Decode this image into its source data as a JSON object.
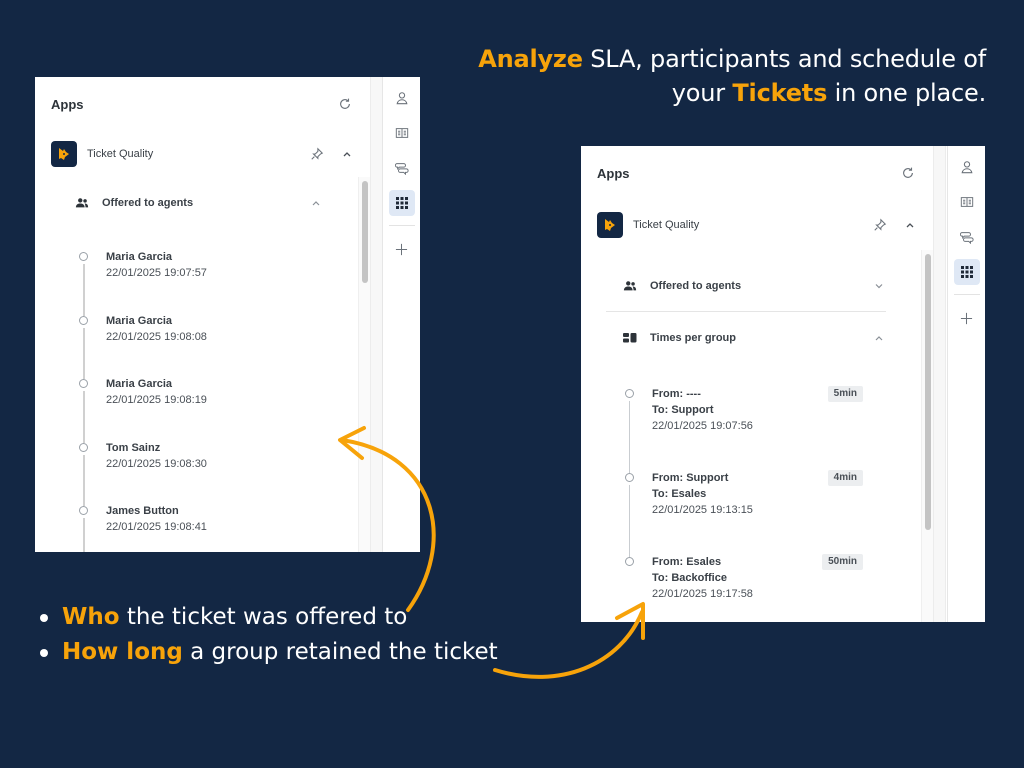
{
  "headline": {
    "accent1": "Analyze",
    "text1": " SLA, participants and schedule of",
    "text2a": "your ",
    "accent2": "Tickets",
    "text2b": " in one place."
  },
  "bullets": [
    {
      "accent": "Who",
      "text": " the ticket was offered to"
    },
    {
      "accent": "How long",
      "text": " a group retained the ticket"
    }
  ],
  "colors": {
    "background": "#132744",
    "accent": "#f7a30a",
    "rail_active": "#dfe8f5"
  },
  "panel1": {
    "apps_title": "Apps",
    "app_name": "Ticket Quality",
    "section": {
      "title": "Offered to agents",
      "state": "expanded"
    },
    "timeline": [
      {
        "name": "Maria Garcia",
        "time": "22/01/2025 19:07:57"
      },
      {
        "name": "Maria Garcia",
        "time": "22/01/2025 19:08:08"
      },
      {
        "name": "Maria Garcia",
        "time": "22/01/2025 19:08:19"
      },
      {
        "name": "Tom Sainz",
        "time": "22/01/2025 19:08:30"
      },
      {
        "name": "James Button",
        "time": "22/01/2025 19:08:41"
      }
    ]
  },
  "panel2": {
    "apps_title": "Apps",
    "app_name": "Ticket Quality",
    "sections": [
      {
        "title": "Offered to agents",
        "state": "collapsed"
      },
      {
        "title": "Times per group",
        "state": "expanded"
      }
    ],
    "timeline": [
      {
        "from": "From: ----",
        "to": "To: Support",
        "time": "22/01/2025 19:07:56",
        "duration": "5min"
      },
      {
        "from": "From: Support",
        "to": "To: Esales",
        "time": "22/01/2025 19:13:15",
        "duration": "4min"
      },
      {
        "from": "From: Esales",
        "to": "To: Backoffice",
        "time": "22/01/2025 19:17:58",
        "duration": "50min"
      }
    ]
  },
  "rail": {
    "icons": [
      "user-icon",
      "book-icon",
      "chat-icon",
      "apps-grid-icon",
      "add-icon"
    ],
    "active": "apps-grid-icon"
  }
}
